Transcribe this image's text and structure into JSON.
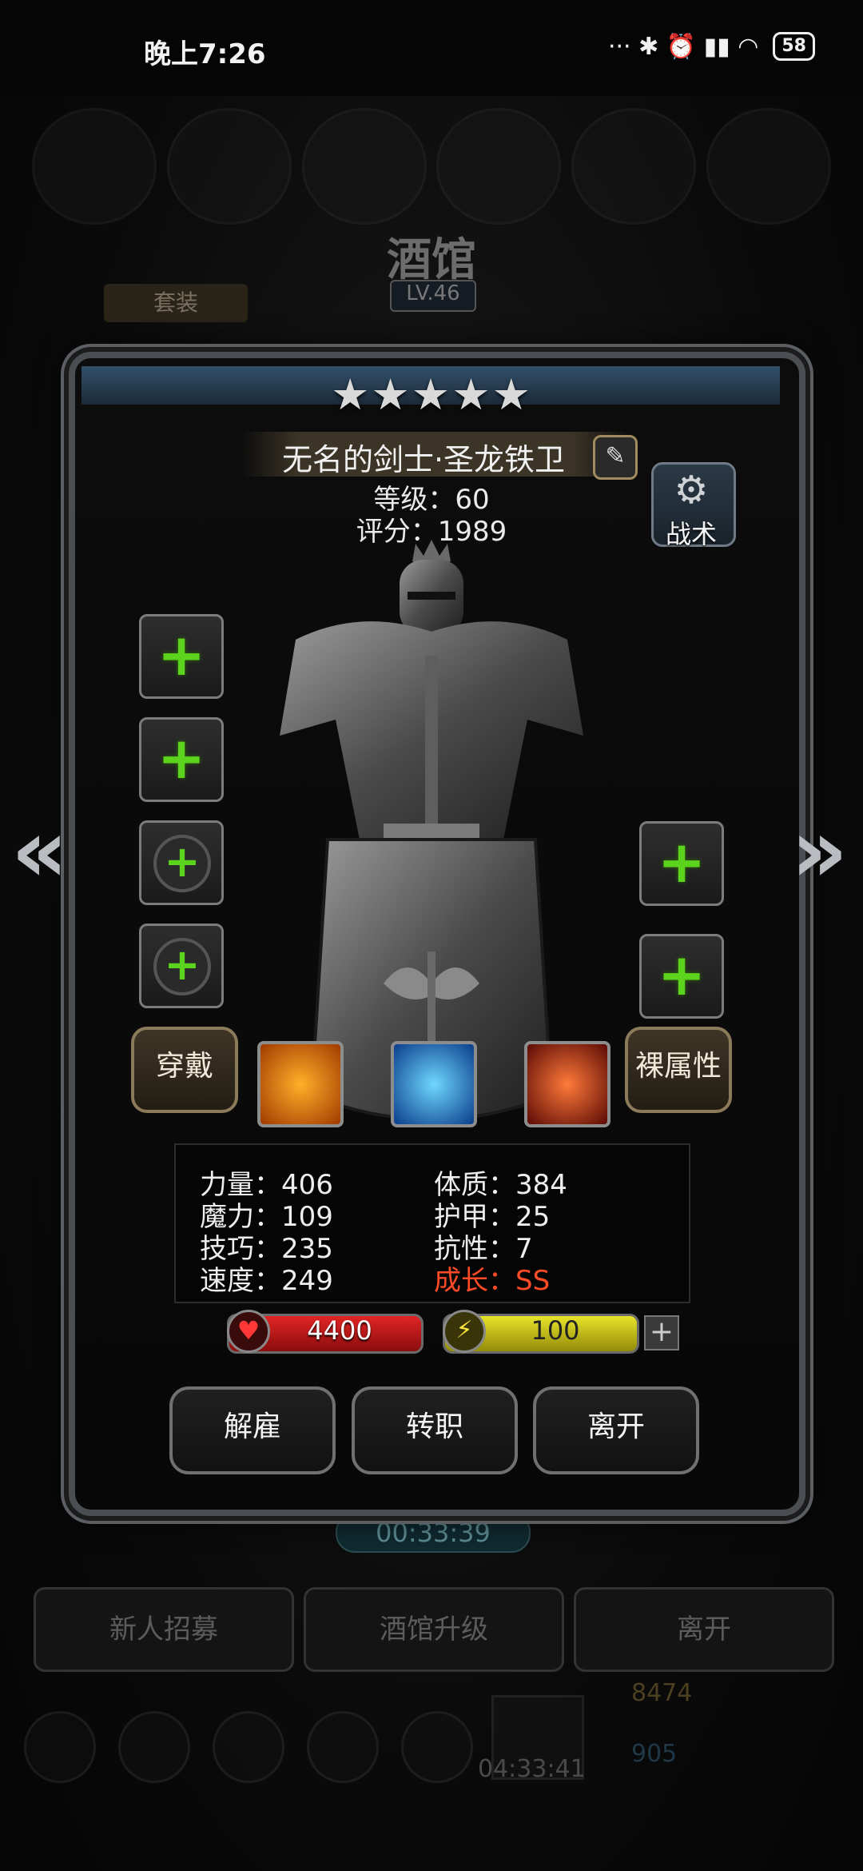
{
  "status_bar": {
    "time": "晚上7:26",
    "icons": "··· ✱ ⏰ ▮▮ ◠",
    "battery": "58"
  },
  "background": {
    "title": "酒馆",
    "level": "LV.46",
    "tab_suit": "套装",
    "timer": "00:33:39",
    "buttons": [
      "新人招募",
      "酒馆升级",
      "离开"
    ],
    "chest_timer": "04:33:41",
    "gold": "8474",
    "gems": "905"
  },
  "hero": {
    "stars": "★★★★★",
    "name": "无名的剑士·圣龙铁卫",
    "level": "等级：60",
    "score": "评分：1989",
    "tactics_label": "战术",
    "equip_label": "穿戴",
    "naked_attr_label": "裸属性"
  },
  "stats": {
    "left": [
      "力量：406",
      "魔力：109",
      "技巧：235",
      "速度：249"
    ],
    "right": [
      "体质：384",
      "护甲：25",
      "抗性：7",
      "成长：SS"
    ]
  },
  "bars": {
    "hp": "4400",
    "energy": "100"
  },
  "actions": {
    "dismiss": "解雇",
    "transfer": "转职",
    "leave": "离开"
  },
  "colors": {
    "accent_plus": "#5cd31c",
    "growth": "#ff4b26",
    "hp": "#e22424",
    "energy": "#e8e42a"
  },
  "icons": [
    "edit-icon",
    "gear-icon",
    "plus-icon",
    "arrow-left-icon",
    "arrow-right-icon",
    "shield-skill-icon",
    "eye-skill-icon",
    "slash-skill-icon",
    "heart-icon",
    "lightning-icon"
  ]
}
